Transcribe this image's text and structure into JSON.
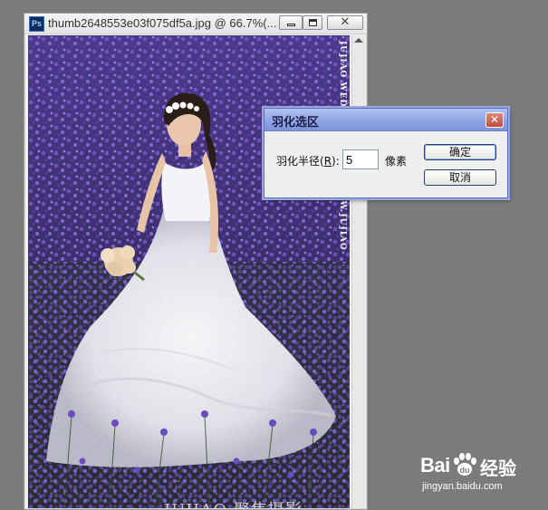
{
  "document": {
    "title": "thumb2648553e03f075df5a.jpg @ 66.7%(...",
    "app_icon": "Ps",
    "close_glyph": "✕",
    "side_watermark": "JUJIAO WEDDING HTTP://WWW.JUJIAO",
    "bottom_watermark": "JUJIAO 聚焦摄影"
  },
  "dialog": {
    "title": "羽化选区",
    "close_glyph": "✕",
    "radius_label_prefix": "羽化半径(",
    "radius_label_key": "R",
    "radius_label_suffix": "):",
    "radius_value": "5",
    "unit": "像素",
    "ok_label": "确定",
    "cancel_label": "取消"
  },
  "watermark": {
    "brand_left": "Bai",
    "brand_right": "经验",
    "url": "jingyan.baidu.com"
  }
}
